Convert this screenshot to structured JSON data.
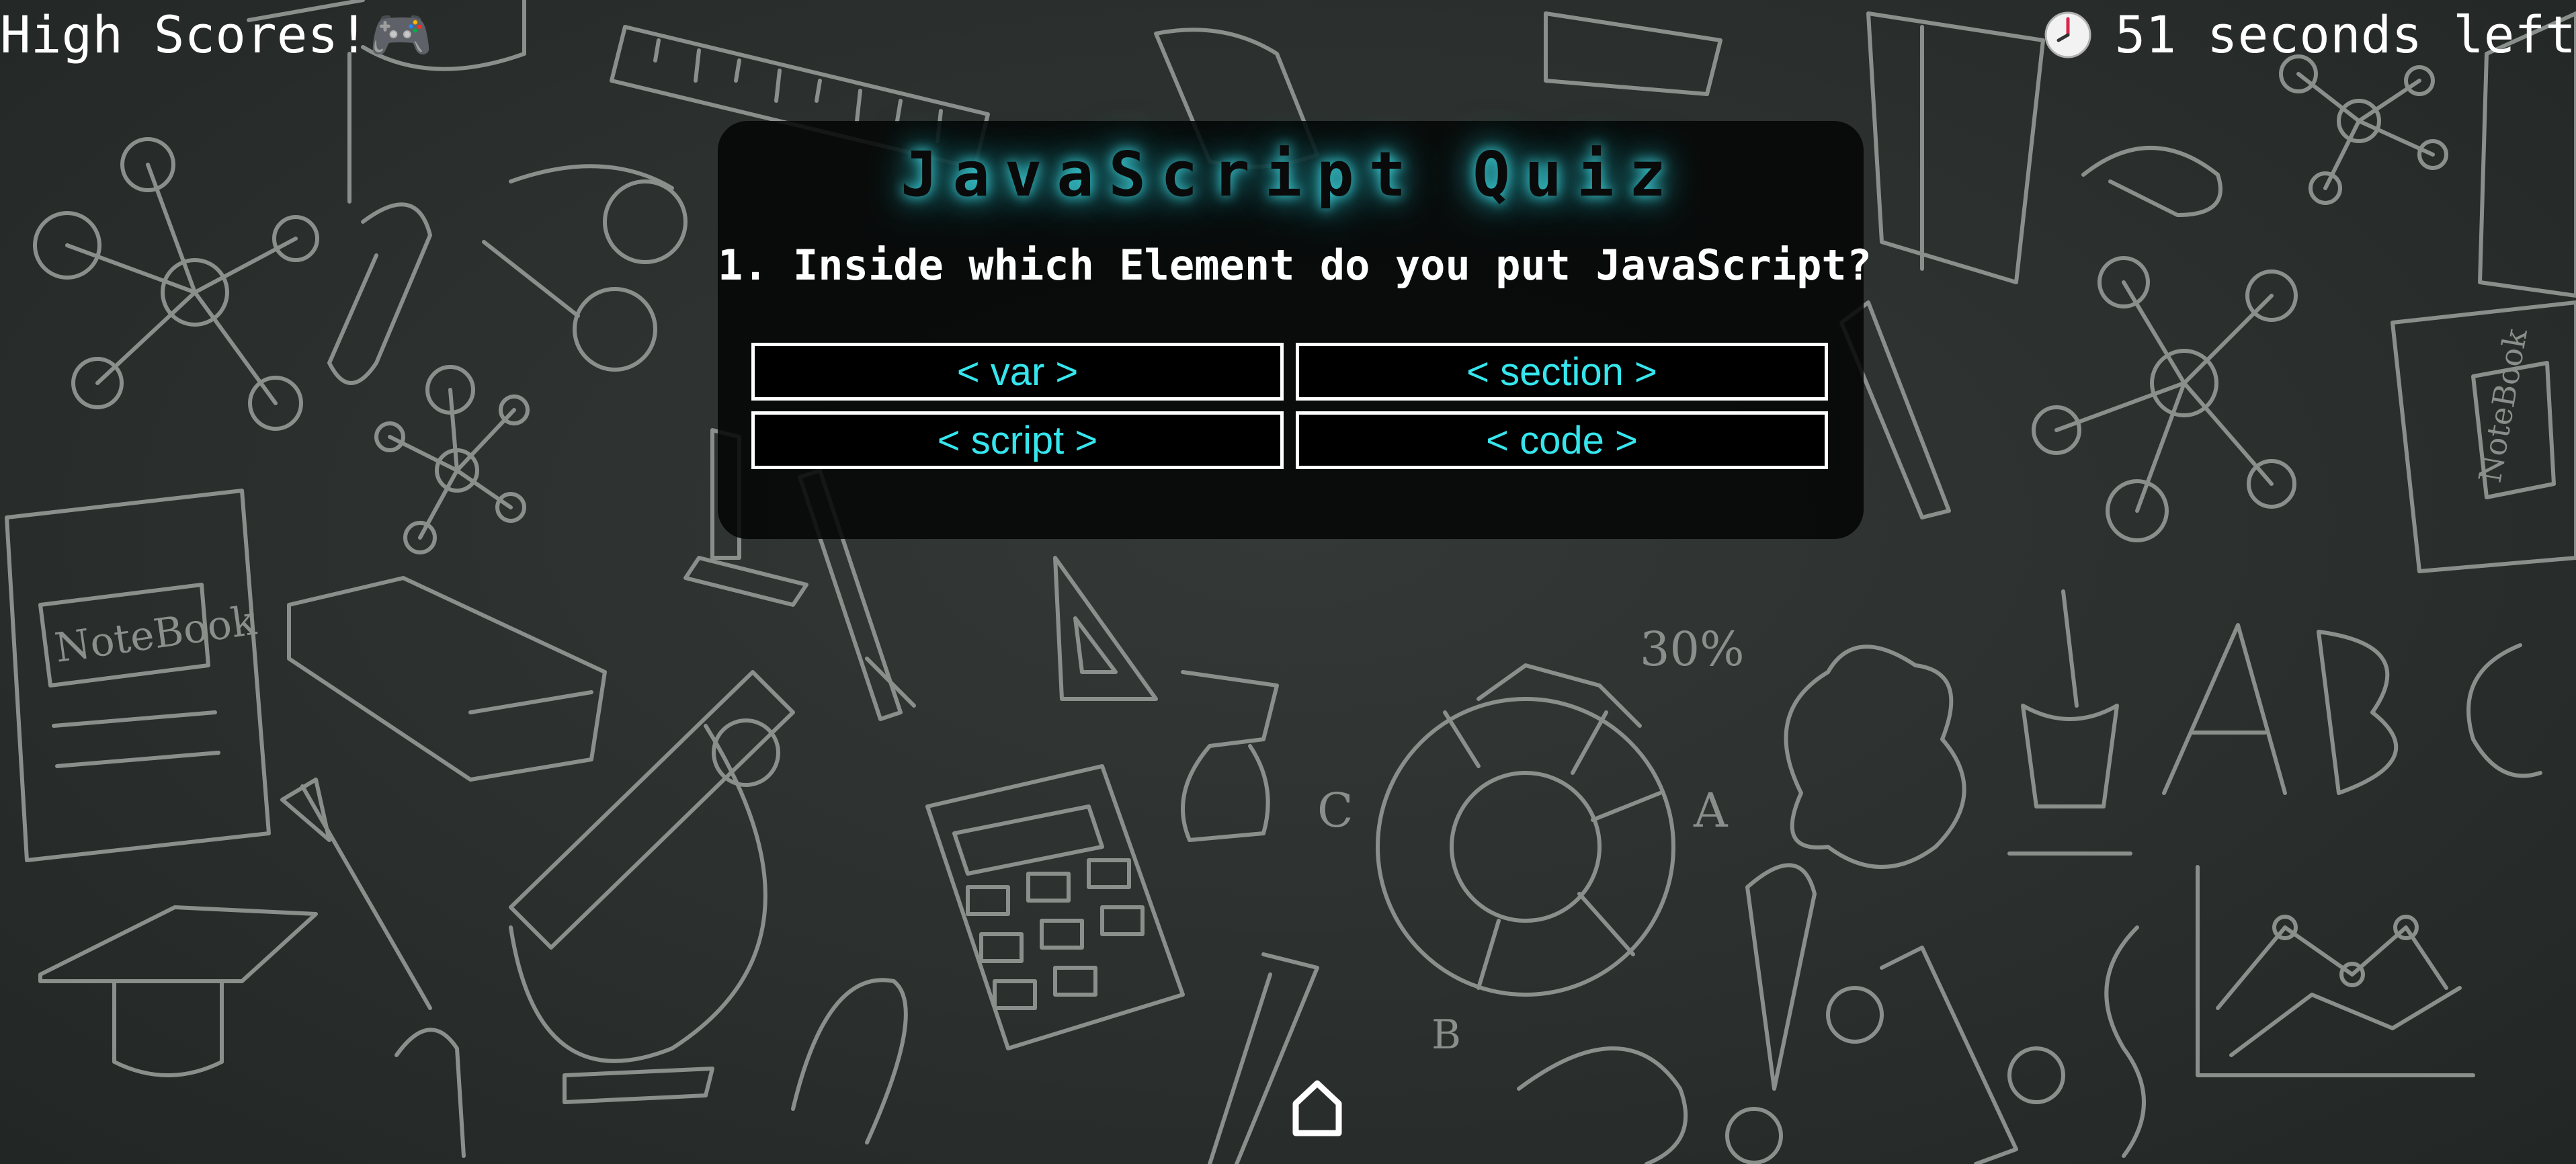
{
  "header": {
    "high_scores_label": "High Scores!🎮",
    "timer_icon": "clock-icon",
    "timer_text": "51 seconds left"
  },
  "quiz": {
    "title": "JavaScript Quiz",
    "question": "1. Inside which Element do you put JavaScript?",
    "answers": [
      {
        "label": "< var >"
      },
      {
        "label": "< section >"
      },
      {
        "label": "< script >"
      },
      {
        "label": "< code >"
      }
    ]
  },
  "footer": {
    "home_icon": "home-icon"
  },
  "colors": {
    "accent": "#35e6ee",
    "title_glow": "#3fd6df",
    "card_background": "#050606",
    "page_background": "#2a2e2c"
  }
}
